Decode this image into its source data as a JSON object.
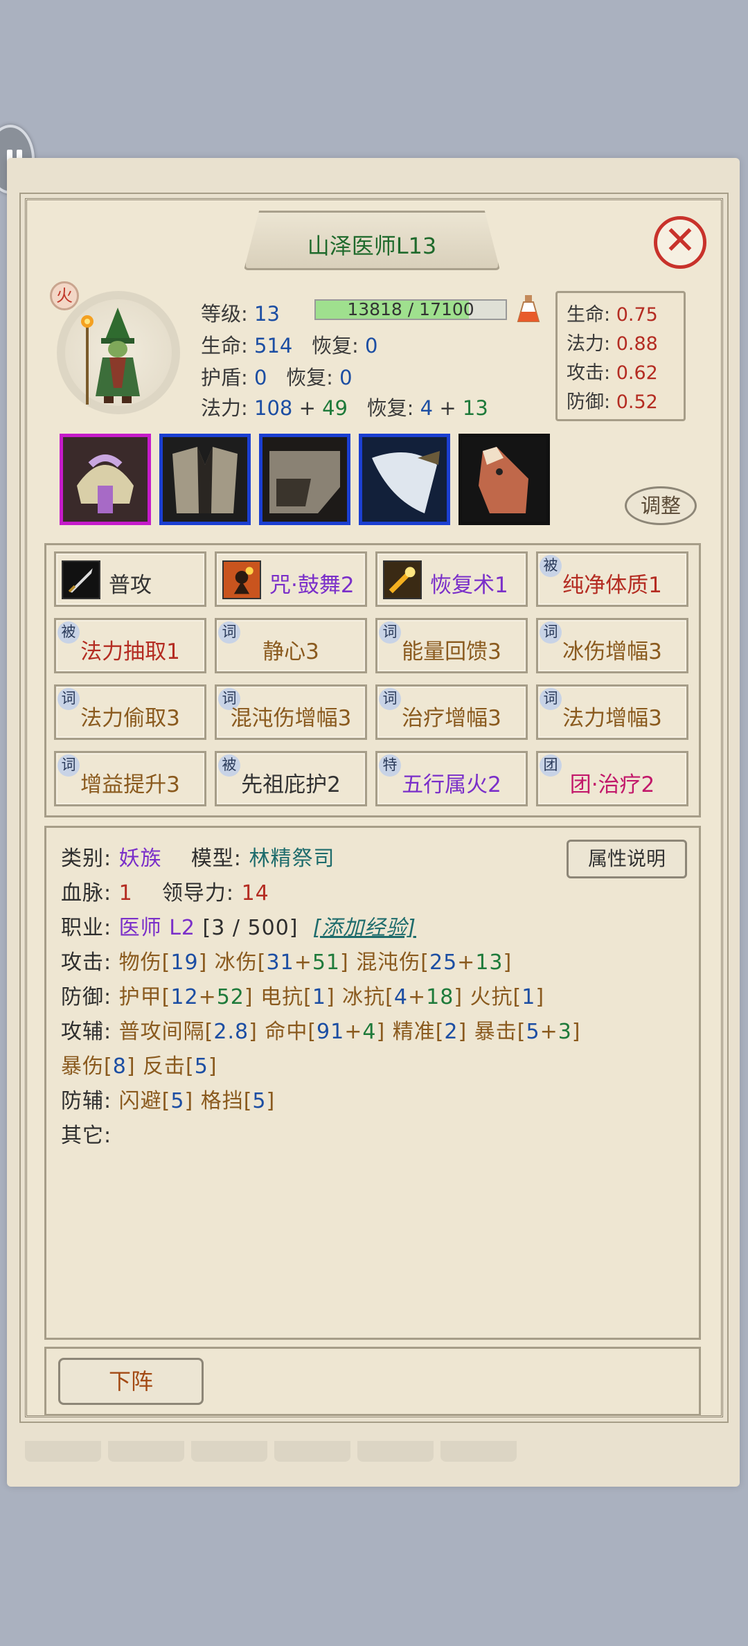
{
  "header": {
    "title": "山泽医师L13"
  },
  "unit": {
    "element": "火",
    "level_label": "等级:",
    "level": "13",
    "exp": {
      "text": "13818 / 17100",
      "fraction": 0.808
    },
    "hp_label": "生命:",
    "hp": "514",
    "recover_label": "恢复:",
    "hp_recover": "0",
    "shield_label": "护盾:",
    "shield": "0",
    "shield_recover": "0",
    "mana_label": "法力:",
    "mana_base": "108",
    "plus": "+",
    "mana_bonus": "49",
    "mana_recover_base": "4",
    "mana_recover_bonus": "13"
  },
  "ratios": [
    {
      "label": "生命:",
      "value": "0.75"
    },
    {
      "label": "法力:",
      "value": "0.88"
    },
    {
      "label": "攻击:",
      "value": "0.62"
    },
    {
      "label": "防御:",
      "value": "0.52"
    }
  ],
  "equipment": [
    {
      "name": "helmet-icon",
      "frame": "pink"
    },
    {
      "name": "armor-icon",
      "frame": "blue"
    },
    {
      "name": "boots-icon",
      "frame": "blue"
    },
    {
      "name": "weapon-icon",
      "frame": "blue"
    },
    {
      "name": "horse-icon",
      "frame": "black"
    }
  ],
  "adjust_label": "调整",
  "skills": [
    {
      "tag": "",
      "label": "普攻",
      "color": "#333333",
      "icon": "sword-icon"
    },
    {
      "tag": "",
      "label": "咒·鼓舞2",
      "color": "#7a2fc9",
      "icon": "drum-icon"
    },
    {
      "tag": "",
      "label": "恢复术1",
      "color": "#7a2fc9",
      "icon": "heal-icon"
    },
    {
      "tag": "被",
      "label": "纯净体质1",
      "color": "#b42c22",
      "icon": ""
    },
    {
      "tag": "被",
      "label": "法力抽取1",
      "color": "#b42c22",
      "icon": ""
    },
    {
      "tag": "词",
      "label": "静心3",
      "color": "#8a5a1e",
      "icon": ""
    },
    {
      "tag": "词",
      "label": "能量回馈3",
      "color": "#8a5a1e",
      "icon": ""
    },
    {
      "tag": "词",
      "label": "冰伤增幅3",
      "color": "#8a5a1e",
      "icon": ""
    },
    {
      "tag": "词",
      "label": "法力偷取3",
      "color": "#8a5a1e",
      "icon": ""
    },
    {
      "tag": "词",
      "label": "混沌伤增幅3",
      "color": "#8a5a1e",
      "icon": ""
    },
    {
      "tag": "词",
      "label": "治疗增幅3",
      "color": "#8a5a1e",
      "icon": ""
    },
    {
      "tag": "词",
      "label": "法力增幅3",
      "color": "#8a5a1e",
      "icon": ""
    },
    {
      "tag": "词",
      "label": "增益提升3",
      "color": "#8a5a1e",
      "icon": ""
    },
    {
      "tag": "被",
      "label": "先祖庇护2",
      "color": "#333333",
      "icon": ""
    },
    {
      "tag": "特",
      "label": "五行属火2",
      "color": "#7a2fc9",
      "icon": ""
    },
    {
      "tag": "团",
      "label": "团·治疗2",
      "color": "#c2186a",
      "icon": ""
    }
  ],
  "info": {
    "category_label": "类别:",
    "category": "妖族",
    "model_label": "模型:",
    "model": "林精祭司",
    "bloodline_label": "血脉:",
    "bloodline": "1",
    "leadership_label": "领导力:",
    "leadership": "14",
    "job_label": "职业:",
    "job": "医师 L2",
    "job_exp": "[3 / 500]",
    "add_exp": "[添加经验]",
    "attack_label": "攻击:",
    "defense_label": "防御:",
    "atk_aux_label": "攻辅:",
    "def_aux_label": "防辅:",
    "other_label": "其它:",
    "attr_button": "属性说明"
  },
  "deploy_label": "下阵"
}
